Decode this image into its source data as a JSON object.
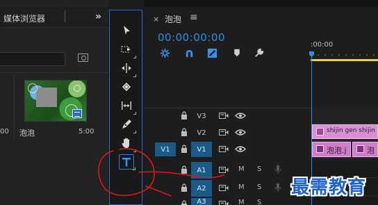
{
  "colors": {
    "accent": "#2d8ceb",
    "tool_border": "#2f66c6",
    "work_area": "#e8d33b",
    "clip_pink": "#d98fd6",
    "track_active": "#1a5b8a",
    "annotation_red": "#e4161b",
    "watermark_blue": "#1d63c9"
  },
  "media_browser": {
    "tab_title": "媒体浏览器",
    "overflow_icon": "double-chevron-right-icon",
    "clip": {
      "name": "泡泡",
      "duration": "5:00",
      "left_duration_fragment": "00"
    }
  },
  "tools": [
    {
      "name": "selection-tool",
      "icon": "arrow-pointer-icon",
      "active": false
    },
    {
      "name": "track-select-forward-tool",
      "icon": "track-select-icon",
      "active": false
    },
    {
      "name": "ripple-edit-tool",
      "icon": "ripple-edit-icon",
      "active": false
    },
    {
      "name": "razor-tool",
      "icon": "razor-icon",
      "active": false
    },
    {
      "name": "slip-tool",
      "icon": "slip-icon",
      "active": false
    },
    {
      "name": "pen-tool",
      "icon": "pen-icon",
      "active": false
    },
    {
      "name": "hand-tool",
      "icon": "hand-icon",
      "active": false
    },
    {
      "name": "type-tool",
      "icon": "type-T-icon",
      "active": true
    }
  ],
  "timeline": {
    "title": "泡泡",
    "timecode": "00:00:00:00",
    "ruler_label": ":00:00",
    "controls": [
      "nest-icon",
      "snap-magnet-icon",
      "linked-selection-icon",
      "add-marker-icon",
      "wrench-icon"
    ],
    "video_tracks": [
      {
        "name": "V3",
        "active": false
      },
      {
        "name": "V2",
        "active": false
      },
      {
        "name": "V1",
        "active": true,
        "source": "V1"
      }
    ],
    "audio_tracks": [
      {
        "name": "A1",
        "active": true,
        "mute": "M",
        "solo": "S"
      },
      {
        "name": "A2",
        "active": true,
        "mute": "M",
        "solo": "S"
      },
      {
        "name": "A3",
        "active": true,
        "mute": "M",
        "solo": "S"
      }
    ],
    "clips": {
      "v2_text": "shijin gen shijin sa",
      "v1_a": "泡泡.j",
      "v1_b": "泡"
    }
  },
  "watermark": "最需教育"
}
